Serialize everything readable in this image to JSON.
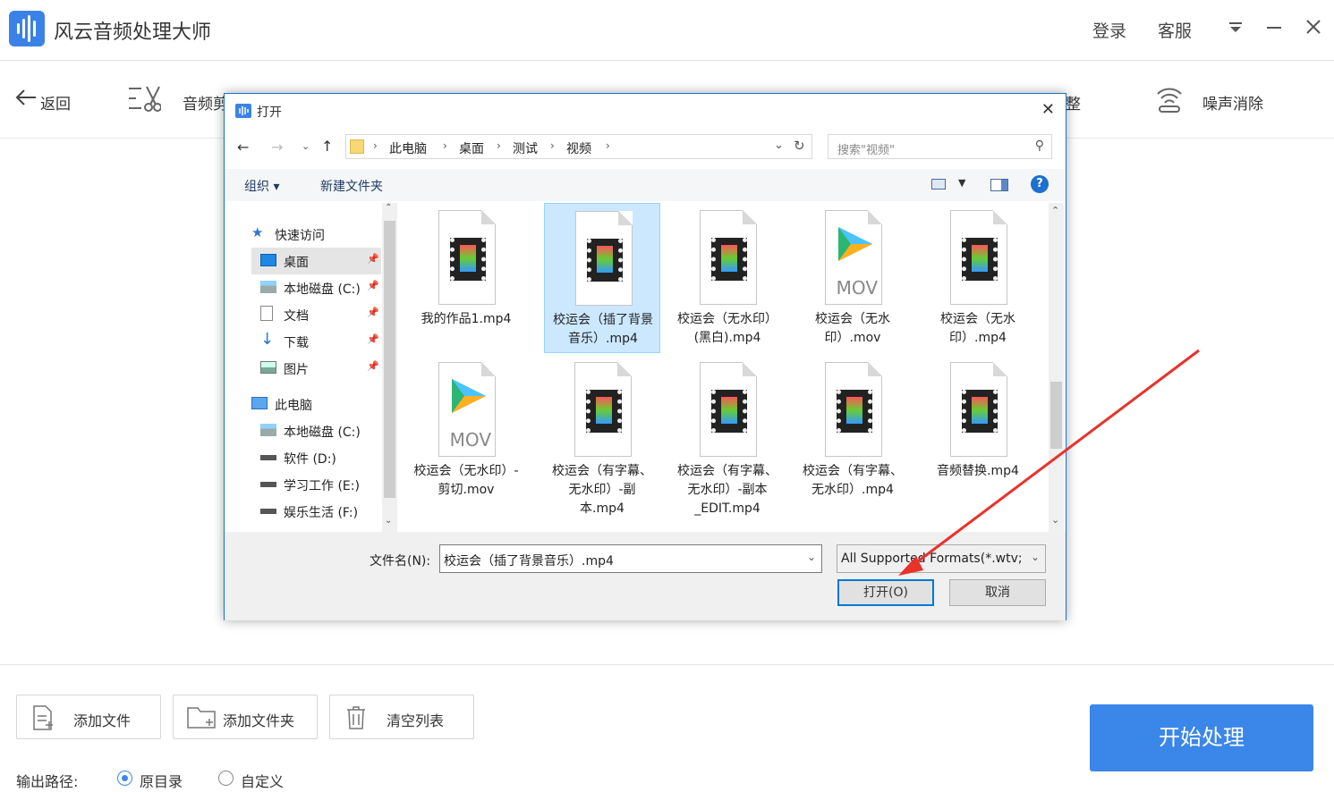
{
  "app": {
    "title": "风云音频处理大师",
    "login": "登录",
    "service": "客服",
    "menu_icon": "dropdown-menu-icon",
    "min_icon": "minimize-icon",
    "close_icon": "close-icon"
  },
  "toolbar": {
    "back": "返回",
    "items": [
      "音频剪",
      "调整",
      "噪声消除"
    ]
  },
  "dialog": {
    "title": "打开",
    "breadcrumb": [
      "此电脑",
      "桌面",
      "测试",
      "视频"
    ],
    "search_placeholder": "搜索\"视频\"",
    "organize": "组织 ▾",
    "new_folder": "新建文件夹",
    "nav": {
      "quick_access": "快速访问",
      "items": [
        {
          "label": "桌面",
          "pinned": true
        },
        {
          "label": "本地磁盘 (C:)",
          "pinned": true
        },
        {
          "label": "文档",
          "pinned": true
        },
        {
          "label": "下载",
          "pinned": true
        },
        {
          "label": "图片",
          "pinned": true
        }
      ],
      "this_pc": "此电脑",
      "drives": [
        "本地磁盘 (C:)",
        "软件 (D:)",
        "学习工作 (E:)",
        "娱乐生活 (F:)"
      ]
    },
    "files": [
      {
        "name": "我的作品1.mp4",
        "type": "video"
      },
      {
        "name": "校运会（插了背景音乐）.mp4",
        "type": "video",
        "selected": true
      },
      {
        "name": "校运会（无水印）(黑白).mp4",
        "type": "video"
      },
      {
        "name": "校运会（无水印）.mov",
        "type": "mov"
      },
      {
        "name": "校运会（无水印）.mp4",
        "type": "video"
      },
      {
        "name": "校运会（无水印）-剪切.mov",
        "type": "mov"
      },
      {
        "name": "校运会（有字幕、无水印）-副本.mp4",
        "type": "video"
      },
      {
        "name": "校运会（有字幕、无水印）-副本_EDIT.mp4",
        "type": "video"
      },
      {
        "name": "校运会（有字幕、无水印）.mp4",
        "type": "video"
      },
      {
        "name": "音频替换.mp4",
        "type": "video"
      }
    ],
    "mov_badge": "MOV",
    "filename_label": "文件名(N):",
    "filename_value": "校运会（插了背景音乐）.mp4",
    "filetype_value": "All Supported Formats(*.wtv;",
    "open": "打开(O)",
    "cancel": "取消"
  },
  "bottom": {
    "add_file": "添加文件",
    "add_folder": "添加文件夹",
    "clear_list": "清空列表",
    "start": "开始处理",
    "output_label": "输出路径:",
    "radio_original": "原目录",
    "radio_custom": "自定义"
  },
  "colors": {
    "accent": "#3b86e9",
    "annotation_arrow": "#e8322c"
  }
}
